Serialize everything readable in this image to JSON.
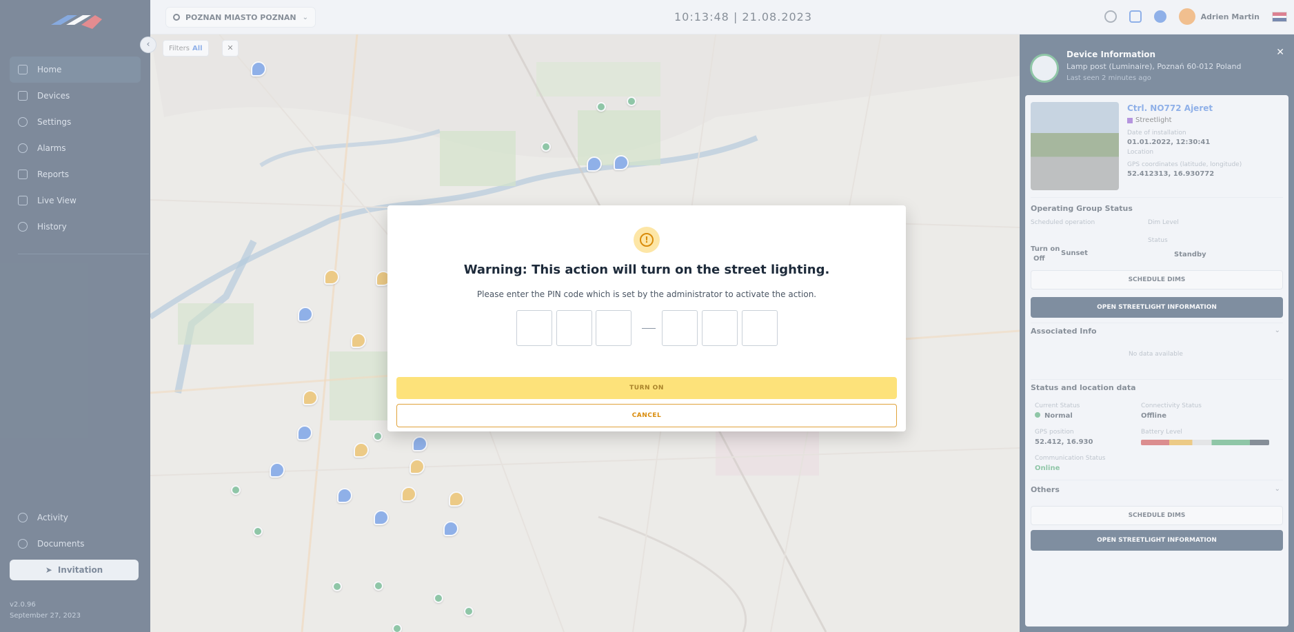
{
  "sidebar": {
    "items": [
      {
        "label": "Home"
      },
      {
        "label": "Devices"
      },
      {
        "label": "Settings"
      },
      {
        "label": "Alarms"
      },
      {
        "label": "Reports"
      },
      {
        "label": "Live View"
      },
      {
        "label": "History"
      }
    ],
    "bottom_items": [
      {
        "label": "Activity"
      },
      {
        "label": "Documents"
      }
    ],
    "button_label": "Invitation",
    "footer_line1": "v2.0.96",
    "footer_line2": "September 27, 2023"
  },
  "topbar": {
    "site_label": "POZNAN MIASTO POZNAN",
    "clock": "10:13:48 | 21.08.2023",
    "user_name": "Adrien Martin"
  },
  "map": {
    "filter_label": "Filters",
    "filter_count": "All"
  },
  "panel": {
    "title": "Device Information",
    "subtitle": "Lamp post (Luminaire), Poznań 60-012 Poland",
    "subtitle2": "Last seen 2 minutes ago",
    "device_name": "Ctrl. NO772 Ajeret",
    "category": "Streetlight",
    "install_label": "Date of installation",
    "install_value": "01.01.2022, 12:30:41",
    "location_label": "Location",
    "coords_label": "GPS coordinates (latitude, longitude)",
    "coords_value": "52.412313, 16.930772",
    "op_title": "Operating Group Status",
    "op_label1": "Scheduled operation",
    "op_label2": "Dim Level",
    "op_val1": "Turn on",
    "op_val2": "Off",
    "op_val3": "Sunset",
    "op_label3": "Status",
    "op_val4": "Standby",
    "btn_schedule": "SCHEDULE DIMS",
    "btn_open": "OPEN STREETLIGHT INFORMATION",
    "sec2_title": "Associated Info",
    "sec2_empty": "No data available",
    "sec3_title": "Status and location data",
    "stat_label1": "Current Status",
    "stat_val1": "Normal",
    "stat_label2": "Connectivity Status",
    "stat_val2": "Offline",
    "stat_label3": "GPS position",
    "stat_val3": "52.412, 16.930",
    "stat_label4": "Battery Level",
    "stat_label5": "Communication Status",
    "stat_val5": "Online",
    "sec4_title": "Others",
    "btn_schedule2": "SCHEDULE DIMS",
    "btn_open2": "OPEN STREETLIGHT INFORMATION"
  },
  "modal": {
    "title": "Warning: This action will turn on the street lighting.",
    "description": "Please enter the PIN code which is set by the administrator to activate the action.",
    "turn_on_label": "TURN ON",
    "cancel_label": "CANCEL"
  },
  "colors": {
    "navy": "#0c2340",
    "accent_yellow": "#fde27a",
    "accent_orange": "#d98b0a",
    "marker_blue": "#2f6fdb",
    "marker_green": "#2e9a59",
    "marker_yellow": "#e8a317"
  },
  "icons": [
    "home-icon",
    "devices-icon",
    "settings-icon",
    "alarm-icon",
    "report-icon",
    "live-icon",
    "history-icon",
    "warning-icon",
    "close-icon",
    "search-icon",
    "bell-icon"
  ]
}
